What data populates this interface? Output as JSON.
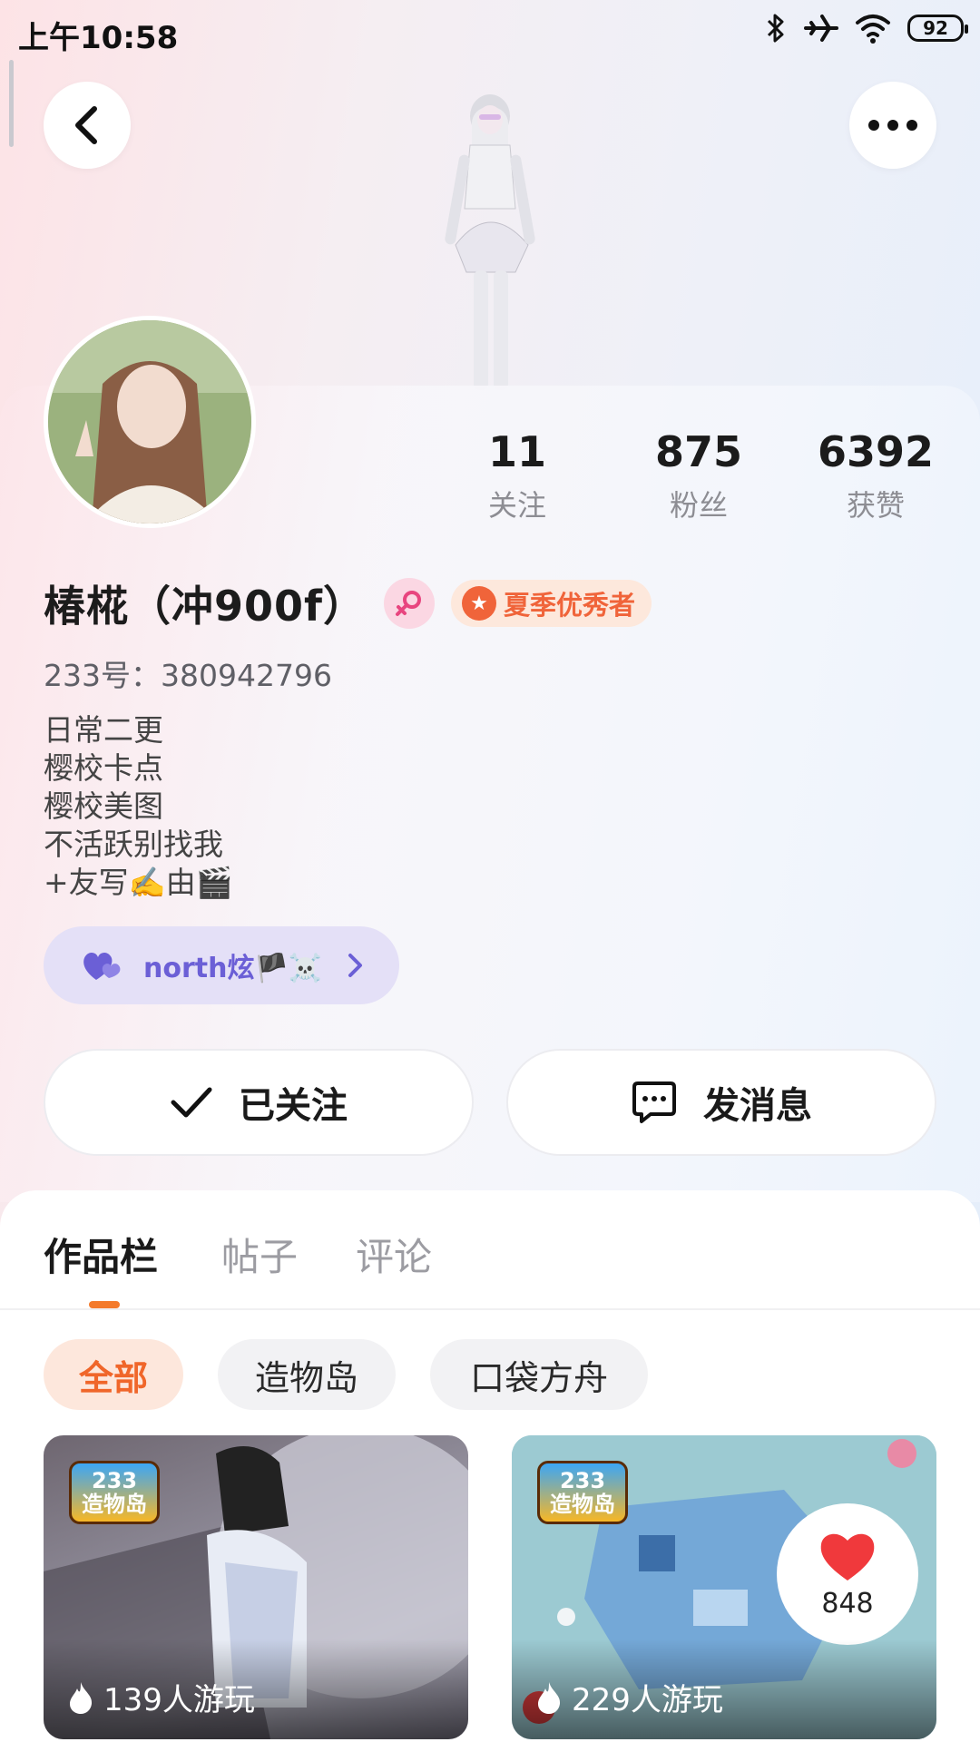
{
  "status_bar": {
    "time": "上午10:58",
    "battery": "92"
  },
  "profile": {
    "stats": [
      {
        "value": "11",
        "label": "关注"
      },
      {
        "value": "875",
        "label": "粉丝"
      },
      {
        "value": "6392",
        "label": "获赞"
      }
    ],
    "name": "椿椛（冲900f）",
    "honor_badge": "夏季优秀者",
    "id_text": "233号：380942796",
    "bio": [
      "日常二更",
      "樱校卡点",
      "樱校美图",
      "不活跃别找我",
      "+友写✍️由🎬"
    ],
    "fan_group": "north炫🏴☠️"
  },
  "actions": {
    "follow": "已关注",
    "message": "发消息"
  },
  "tabs": [
    {
      "label": "作品栏",
      "active": true
    },
    {
      "label": "帖子",
      "active": false
    },
    {
      "label": "评论",
      "active": false
    }
  ],
  "filters": [
    {
      "label": "全部",
      "active": true
    },
    {
      "label": "造物岛",
      "active": false
    },
    {
      "label": "口袋方舟",
      "active": false
    }
  ],
  "cards": [
    {
      "logo_line1": "233",
      "logo_line2": "造物岛",
      "players": "139人游玩"
    },
    {
      "logo_line1": "233",
      "logo_line2": "造物岛",
      "players": "229人游玩",
      "likes": "848"
    }
  ],
  "colors": {
    "accent": "#f0662a",
    "fan_group": "#6b5fd6"
  }
}
